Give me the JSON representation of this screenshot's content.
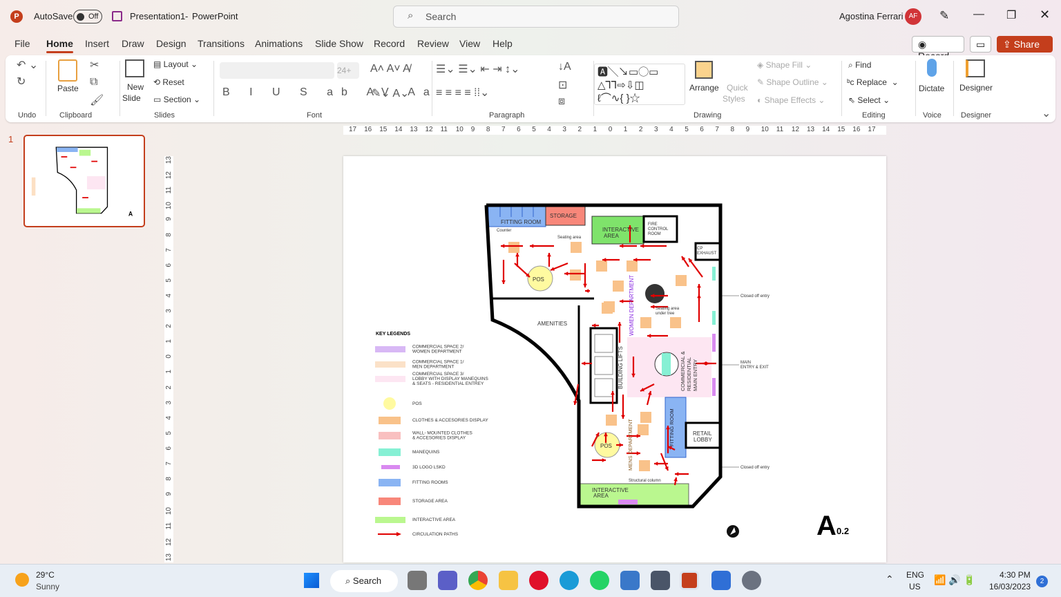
{
  "titlebar": {
    "autosave": "AutoSave",
    "toggle": "Off",
    "doc": "Presentation1",
    "sep": "-",
    "app": "PowerPoint",
    "search_placeholder": "Search",
    "user": "Agostina Ferrari",
    "initials": "AF"
  },
  "tabs": [
    "File",
    "Home",
    "Insert",
    "Draw",
    "Design",
    "Transitions",
    "Animations",
    "Slide Show",
    "Record",
    "Review",
    "View",
    "Help"
  ],
  "top_buttons": {
    "record": "Record",
    "share": "Share"
  },
  "ribbon": {
    "undo_group": "Undo",
    "clipboard_group": "Clipboard",
    "paste": "Paste",
    "slides_group": "Slides",
    "new_slide": "New",
    "new_slide2": "Slide",
    "layout": "Layout",
    "reset": "Reset",
    "section": "Section",
    "font_group": "Font",
    "font_size": "24+",
    "paragraph_group": "Paragraph",
    "drawing_group": "Drawing",
    "arrange": "Arrange",
    "quick_styles": "Quick",
    "quick_styles2": "Styles",
    "shape_fill": "Shape Fill",
    "shape_outline": "Shape Outline",
    "shape_effects": "Shape Effects",
    "editing_group": "Editing",
    "find": "Find",
    "replace": "Replace",
    "select": "Select",
    "voice_group": "Voice",
    "dictate": "Dictate",
    "designer_group": "Designer",
    "designer": "Designer"
  },
  "slide_panel": {
    "number": "1"
  },
  "ruler_h": [
    "17",
    "16",
    "15",
    "14",
    "13",
    "12",
    "11",
    "10",
    "9",
    "8",
    "7",
    "6",
    "5",
    "4",
    "3",
    "2",
    "1",
    "0",
    "1",
    "2",
    "3",
    "4",
    "5",
    "6",
    "7",
    "8",
    "9",
    "10",
    "11",
    "12",
    "13",
    "14",
    "15",
    "16",
    "17"
  ],
  "ruler_v": [
    "13",
    "12",
    "11",
    "10",
    "9",
    "8",
    "7",
    "6",
    "5",
    "4",
    "3",
    "2",
    "1",
    "0",
    "1",
    "2",
    "3",
    "4",
    "5",
    "6",
    "7",
    "8",
    "9",
    "10",
    "11",
    "12",
    "13"
  ],
  "plan": {
    "fitting_room": "FITTING ROOM",
    "storage": "STORAGE",
    "interactive_top": [
      "INTERACTIVE",
      "AREA"
    ],
    "fire_control": [
      "FIRE",
      "CONTROL",
      "ROOM"
    ],
    "cp_exhaust": [
      "CP",
      "EXHAUST"
    ],
    "counter": "Counter",
    "seating": "Seating area",
    "seating_tree": [
      "Seating area",
      "under tree"
    ],
    "pos": "POS",
    "amenities": "AMENITIES",
    "women": "WOMEN DEPARTMENT",
    "lifts": "BUILDING LIFTS",
    "main_entry": [
      "COMMERCIAL &",
      "RESIDENTIAL",
      "MAIN ENTRY"
    ],
    "fitting_room2": "FITTING ROOM",
    "retail_lobby": [
      "RETAIL",
      "LOBBY"
    ],
    "mens": "MENS DEPARTMENT",
    "structural": "Structural column",
    "interactive_bottom": [
      "INTERACTIVE",
      "AREA"
    ],
    "closed1": "Closed off entry",
    "closed2": "Closed off entry",
    "main_exit": [
      "MAIN",
      "ENTRY & EXIT"
    ],
    "sheet": "A",
    "sheet_sub": "0.2"
  },
  "legend": {
    "title": "KEY LEGENDS",
    "items": [
      {
        "label": [
          "COMMERCIAL SPACE 2/",
          "WOMEN DEPARTMENT"
        ],
        "color": "#d8b8f5"
      },
      {
        "label": [
          "COMMERCIAL SPACE 1/",
          "MEN DEPARTMENT"
        ],
        "color": "#fbe1c8"
      },
      {
        "label": [
          "COMMERCIAL SPACE 3/",
          "LOBBY WITH DISPLAY MANEQUINS",
          "& SEATS - RESIDENTIAL ENTREY"
        ],
        "color": "#fde6f2"
      },
      {
        "label": [
          "POS"
        ],
        "color": "#fffaa0"
      },
      {
        "label": [
          "CLOTHES & ACCESORIES DISPLAY"
        ],
        "color": "#f9c28a"
      },
      {
        "label": [
          "WALL- MOUNTED CLOTHES",
          "& ACCESORIES DISPLAY"
        ],
        "color": "#f9c0c0"
      },
      {
        "label": [
          "MANEQUINS"
        ],
        "color": "#86f0d4"
      },
      {
        "label": [
          "3D LOGO LSKD"
        ],
        "color": "#d98af0"
      },
      {
        "label": [
          "FITTING ROOMS"
        ],
        "color": "#8ab4f3"
      },
      {
        "label": [
          "STORAGE AREA"
        ],
        "color": "#f8877a"
      },
      {
        "label": [
          "INTERACTIVE AREA"
        ],
        "color": "#baf78f"
      },
      {
        "label": [
          "CIRCULATION PATHS"
        ],
        "color": "#e00000"
      }
    ]
  },
  "taskbar": {
    "temp": "29°C",
    "weather": "Sunny",
    "search": "Search",
    "lang1": "ENG",
    "lang2": "US",
    "time": "4:30 PM",
    "date": "16/03/2023",
    "badge": "2"
  },
  "colors": {
    "accent": "#c43e1c",
    "arrow": "#e00000"
  }
}
